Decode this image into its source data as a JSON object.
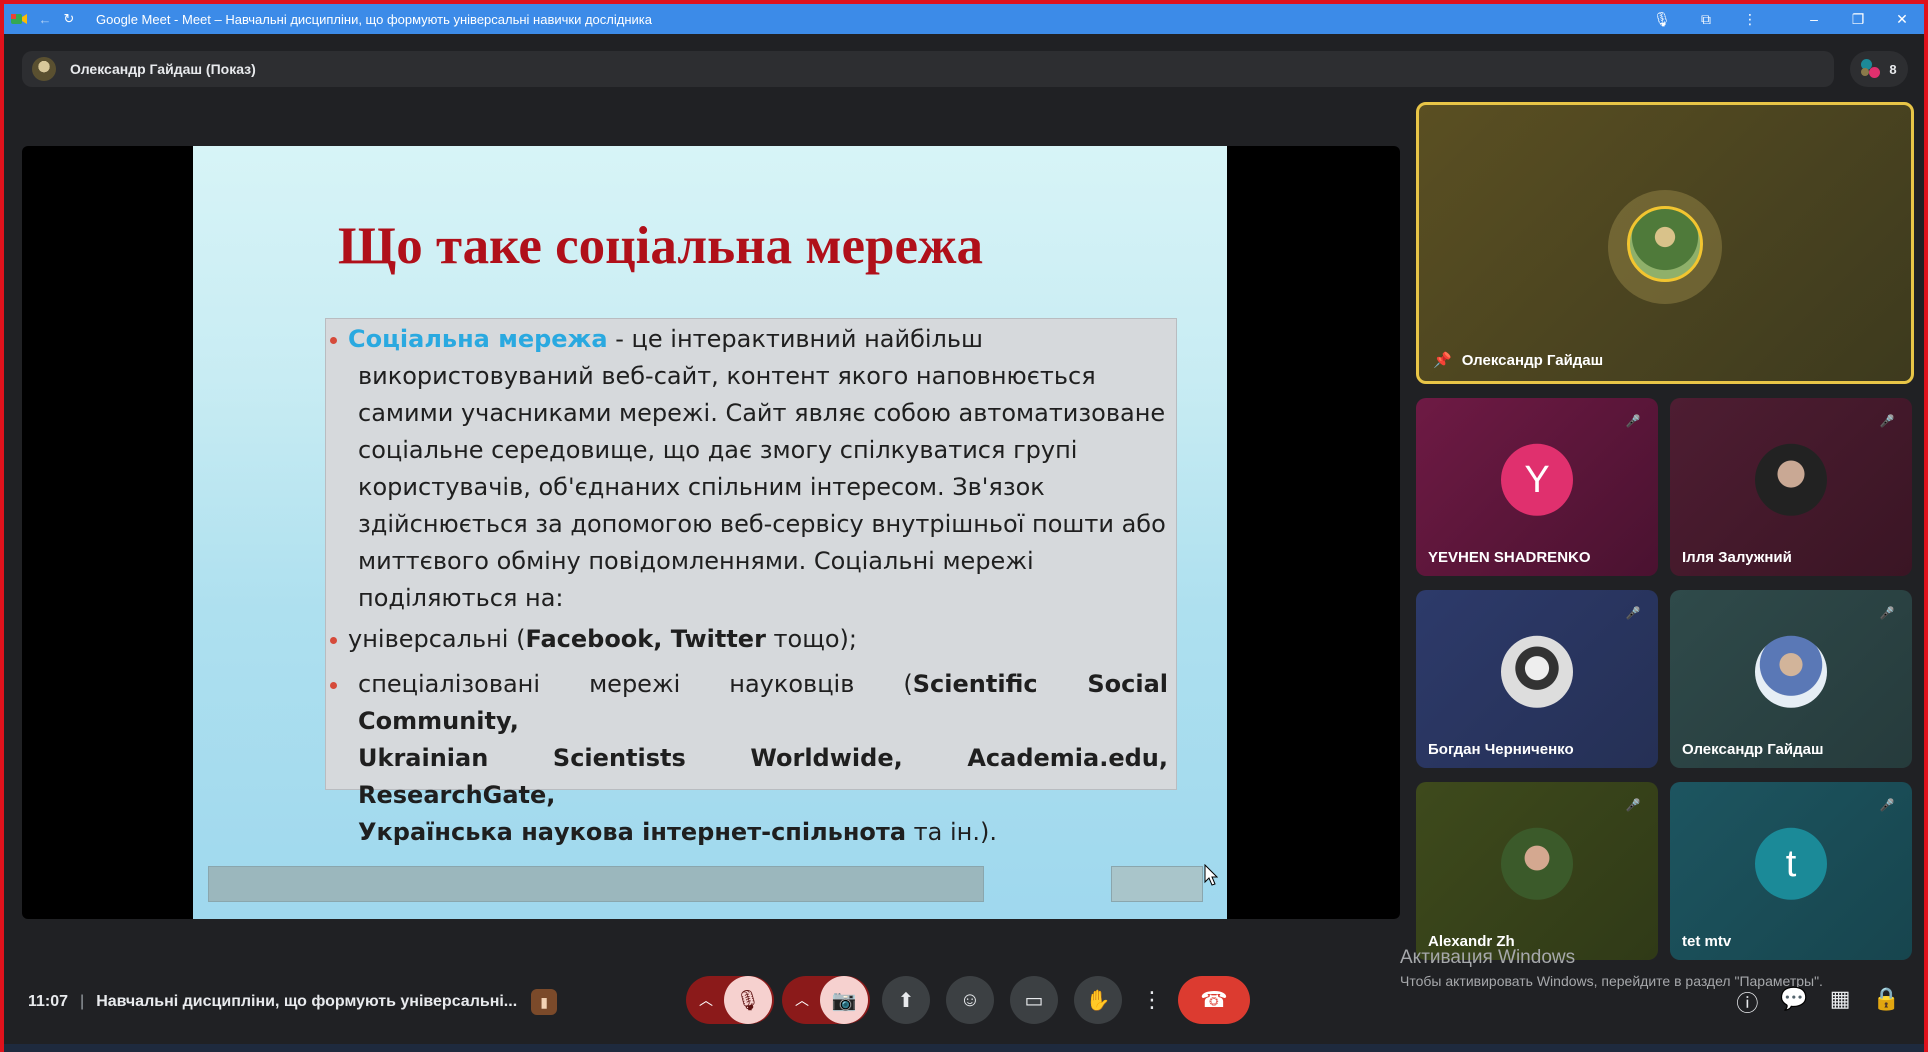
{
  "browser": {
    "title": "Google Meet - Meet – Навчальні дисципліни, що формують універсальні навички дослідника",
    "icons": [
      "back-arrow-icon",
      "reload-icon",
      "mic-icon",
      "extension-icon",
      "more-vert-icon",
      "minimize-icon",
      "restore-icon",
      "close-icon"
    ]
  },
  "presenter_pill": {
    "label": "Олександр Гайдаш (Показ)"
  },
  "people_badge": {
    "count": "8"
  },
  "slide": {
    "title": "Що таке соціальна мережа",
    "term": "Соціальна мережа",
    "intro_rest": " - це інтерактивний найбільш",
    "lines": [
      "використовуваний веб-сайт, контент якого наповнюється",
      "самими учасниками мережі. Сайт являє собою автоматизоване",
      "соціальне середовище, що дає змогу спілкуватися групі",
      "користувачів, об'єднаних спільним інтересом. Зв'язок",
      "здійснюється за допомогою веб-сервісу внутрішньої пошти або",
      "миттєвого обміну повідомленнями. Соціальні мережі",
      "поділяються на:"
    ],
    "bullet2_pre": "універсальні (",
    "bullet2_bold": "Facebook, Twitter",
    "bullet2_post": " тощо);",
    "bullet3_pre": "спеціалізовані мережі науковців (",
    "bullet3_bold1": "Scientific Social Community,",
    "bullet3_bold2": "Ukrainian Scientists Worldwide, Academia.edu, ResearchGate,",
    "bullet3_bold3": "Українська наукова інтернет-спільнота",
    "bullet3_post": " та ін.)."
  },
  "tiles": [
    {
      "name": "Олександр Гайдаш",
      "pinned": true
    },
    {
      "name": "YEVHEN SHADRENKO",
      "initial": "Y",
      "color": "#e0306e"
    },
    {
      "name": "Ілля Залужний"
    },
    {
      "name": "Богдан Черниченко"
    },
    {
      "name": "Олександр Гайдаш"
    },
    {
      "name": "Alexandr Zh"
    },
    {
      "name": "tet mtv",
      "initial": "t",
      "color": "#1b8a98"
    }
  ],
  "bottom": {
    "time": "11:07",
    "meeting_title": "Навчальні дисципліни, що формують універсальні..."
  },
  "activation": {
    "line1": "Активация Windows",
    "line2": "Чтобы активировать Windows, перейдите в раздел \"Параметры\"."
  }
}
